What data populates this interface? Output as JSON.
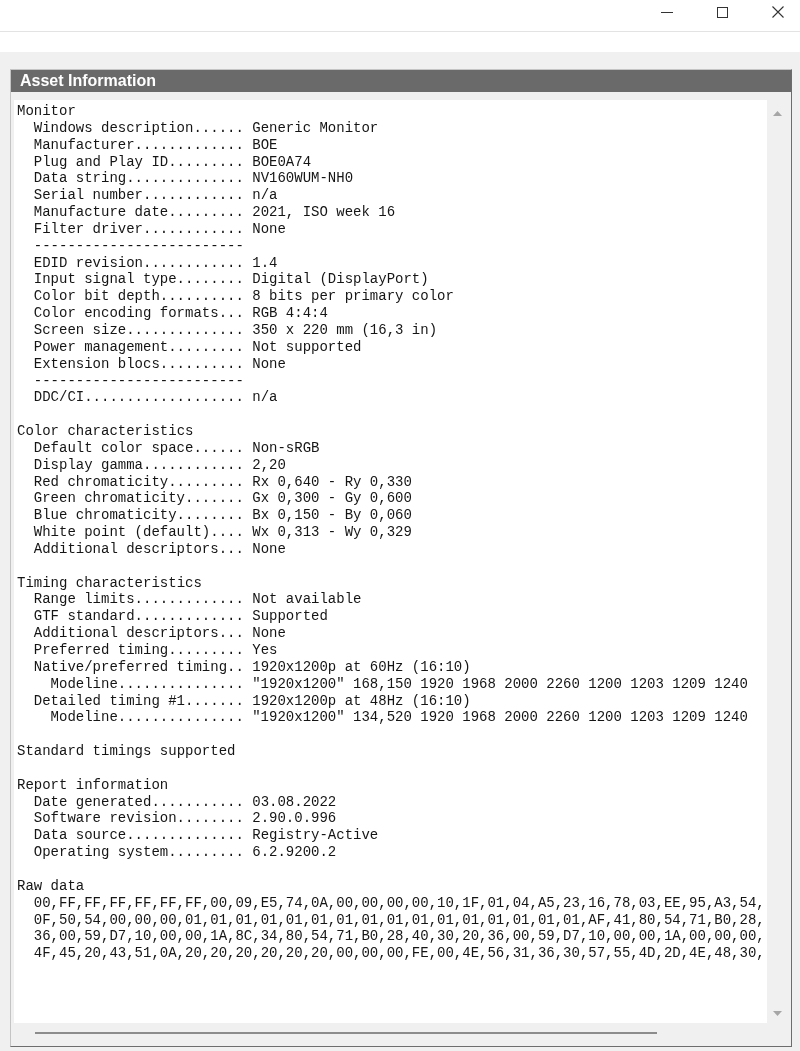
{
  "panel": {
    "title": "Asset Information"
  },
  "report": {
    "sections": [
      {
        "heading": "Monitor",
        "items": [
          {
            "kind": "field",
            "label": "Windows description......",
            "value": "Generic Monitor"
          },
          {
            "kind": "field",
            "label": "Manufacturer.............",
            "value": "BOE"
          },
          {
            "kind": "field",
            "label": "Plug and Play ID.........",
            "value": "BOE0A74"
          },
          {
            "kind": "field",
            "label": "Data string..............",
            "value": "NV160WUM-NH0"
          },
          {
            "kind": "field",
            "label": "Serial number............",
            "value": "n/a"
          },
          {
            "kind": "field",
            "label": "Manufacture date.........",
            "value": "2021, ISO week 16"
          },
          {
            "kind": "field",
            "label": "Filter driver............",
            "value": "None"
          },
          {
            "kind": "rule",
            "text": "-------------------------"
          },
          {
            "kind": "field",
            "label": "EDID revision............",
            "value": "1.4"
          },
          {
            "kind": "field",
            "label": "Input signal type........",
            "value": "Digital (DisplayPort)"
          },
          {
            "kind": "field",
            "label": "Color bit depth..........",
            "value": "8 bits per primary color"
          },
          {
            "kind": "field",
            "label": "Color encoding formats...",
            "value": "RGB 4:4:4"
          },
          {
            "kind": "field",
            "label": "Screen size..............",
            "value": "350 x 220 mm (16,3 in)"
          },
          {
            "kind": "field",
            "label": "Power management.........",
            "value": "Not supported"
          },
          {
            "kind": "field",
            "label": "Extension blocs..........",
            "value": "None"
          },
          {
            "kind": "rule",
            "text": "-------------------------"
          },
          {
            "kind": "field",
            "label": "DDC/CI...................",
            "value": "n/a"
          }
        ]
      },
      {
        "heading": "Color characteristics",
        "items": [
          {
            "kind": "field",
            "label": "Default color space......",
            "value": "Non-sRGB"
          },
          {
            "kind": "field",
            "label": "Display gamma............",
            "value": "2,20"
          },
          {
            "kind": "field",
            "label": "Red chromaticity.........",
            "value": "Rx 0,640 - Ry 0,330"
          },
          {
            "kind": "field",
            "label": "Green chromaticity.......",
            "value": "Gx 0,300 - Gy 0,600"
          },
          {
            "kind": "field",
            "label": "Blue chromaticity........",
            "value": "Bx 0,150 - By 0,060"
          },
          {
            "kind": "field",
            "label": "White point (default)....",
            "value": "Wx 0,313 - Wy 0,329"
          },
          {
            "kind": "field",
            "label": "Additional descriptors...",
            "value": "None"
          }
        ]
      },
      {
        "heading": "Timing characteristics",
        "items": [
          {
            "kind": "field",
            "label": "Range limits.............",
            "value": "Not available"
          },
          {
            "kind": "field",
            "label": "GTF standard.............",
            "value": "Supported"
          },
          {
            "kind": "field",
            "label": "Additional descriptors...",
            "value": "None"
          },
          {
            "kind": "field",
            "label": "Preferred timing.........",
            "value": "Yes"
          },
          {
            "kind": "field",
            "label": "Native/preferred timing..",
            "value": "1920x1200p at 60Hz (16:10)",
            "children": [
              {
                "kind": "field",
                "label": "Modeline...............",
                "value": "\"1920x1200\" 168,150 1920 1968 2000 2260 1200 1203 1209 1240"
              }
            ]
          },
          {
            "kind": "field",
            "label": "Detailed timing #1.......",
            "value": "1920x1200p at 48Hz (16:10)",
            "children": [
              {
                "kind": "field",
                "label": "Modeline...............",
                "value": "\"1920x1200\" 134,520 1920 1968 2000 2260 1200 1203 1209 1240"
              }
            ]
          }
        ]
      },
      {
        "heading": "Standard timings supported"
      },
      {
        "heading": "Report information",
        "items": [
          {
            "kind": "field",
            "label": "Date generated...........",
            "value": "03.08.2022"
          },
          {
            "kind": "field",
            "label": "Software revision........",
            "value": "2.90.0.996"
          },
          {
            "kind": "field",
            "label": "Data source..............",
            "value": "Registry-Active"
          },
          {
            "kind": "field",
            "label": "Operating system.........",
            "value": "6.2.9200.2"
          }
        ]
      },
      {
        "heading": "Raw data",
        "lines": [
          "00,FF,FF,FF,FF,FF,FF,00,09,E5,74,0A,00,00,00,00,10,1F,01,04,A5,23,16,78,03,EE,95,A3,54,",
          "0F,50,54,00,00,00,01,01,01,01,01,01,01,01,01,01,01,01,01,01,01,01,AF,41,80,54,71,B0,28,",
          "36,00,59,D7,10,00,00,1A,8C,34,80,54,71,B0,28,40,30,20,36,00,59,D7,10,00,00,1A,00,00,00,",
          "4F,45,20,43,51,0A,20,20,20,20,20,20,00,00,00,FE,00,4E,56,31,36,30,57,55,4D,2D,4E,48,30,"
        ]
      }
    ]
  }
}
